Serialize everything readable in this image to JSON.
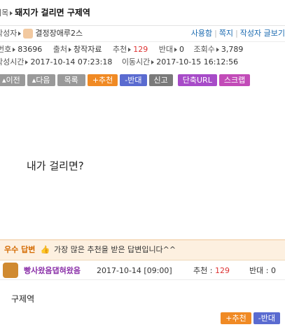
{
  "post": {
    "title_label": "제목",
    "title": "돼지가 걸리면 구제역",
    "author_label": "작성자",
    "author": "결정장애루2스",
    "links": [
      "사용함",
      "쪽지",
      "작성자 글보기"
    ],
    "no_label": "번호",
    "no": "83696",
    "category_label": "출처",
    "category": "창작자료",
    "rec_label": "추천",
    "rec": "129",
    "opp_label": "반대",
    "opp": "0",
    "views_label": "조회수",
    "views": "3,789",
    "created_label": "작성시간",
    "created": "2017-10-14 07:23:18",
    "moved_label": "이동시간",
    "moved": "2017-10-15 16:12:56",
    "body": "내가 걸리면?"
  },
  "buttons": [
    "이전",
    "다음",
    "목록",
    "추천",
    "반대",
    "신고",
    "단축URL",
    "스크랩"
  ],
  "best_answer": {
    "badge": "우수 답변",
    "desc": "가장 많은 추천을 받은 답변입니다^^",
    "author": "빵사왔음댑혀왔음",
    "date": "2017-10-14 [09:00]",
    "rec_label": "추천",
    "rec": "129",
    "opp_label": "반대",
    "opp": "0",
    "text": "구제역",
    "rec_button": "추천",
    "opp_button": "반대"
  }
}
